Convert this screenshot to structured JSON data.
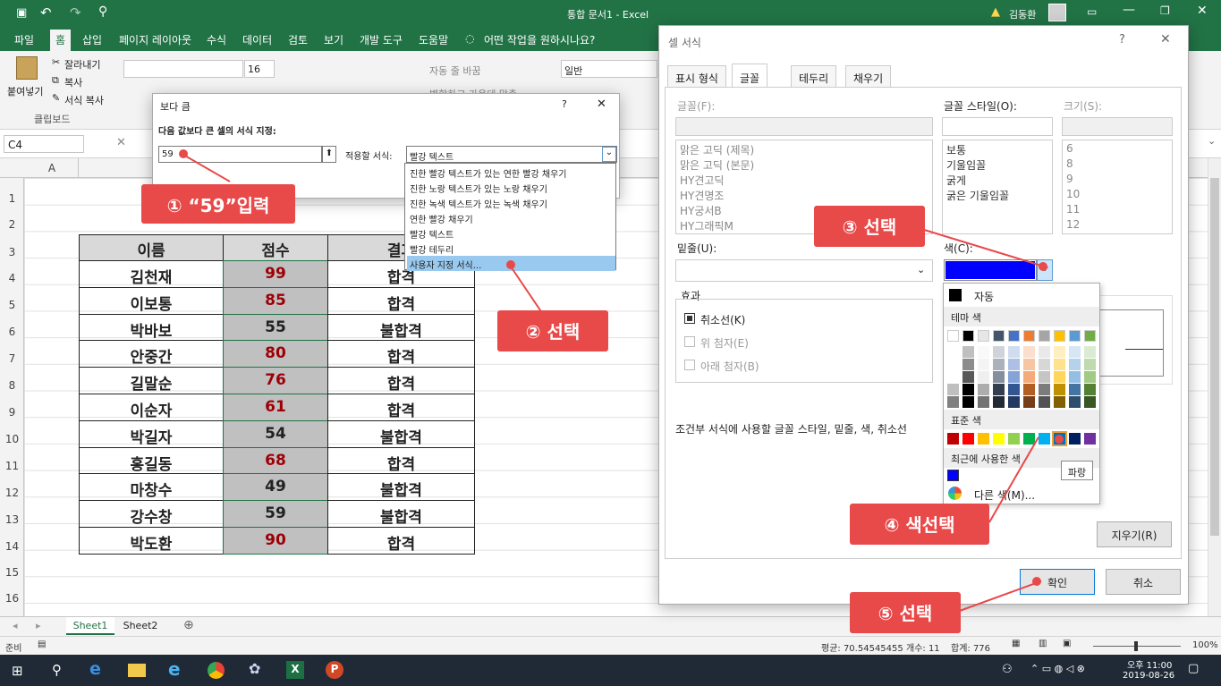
{
  "window": {
    "title": "통합 문서1 - Excel",
    "user": "김동환"
  },
  "menu": {
    "items": [
      "파일",
      "홈",
      "삽입",
      "페이지 레이아웃",
      "수식",
      "데이터",
      "검토",
      "보기",
      "개발 도구",
      "도움말"
    ],
    "tellme": "어떤 작업을 원하시나요?"
  },
  "ribbon": {
    "paste": "붙여넣기",
    "cut": "잘라내기",
    "copy": "복사",
    "format_painter": "서식 복사",
    "clipboard": "클립보드",
    "font_size": "16",
    "wrap": "자동 줄 바꿈",
    "merge": "병합하고 가운데 맞춤",
    "number_format": "일반"
  },
  "formula_bar": {
    "name_box": "C4"
  },
  "columns": [
    "A"
  ],
  "rows": [
    "1",
    "2",
    "3",
    "4",
    "5",
    "6",
    "7",
    "8",
    "9",
    "10",
    "11",
    "12",
    "13",
    "14",
    "15",
    "16"
  ],
  "table": {
    "headers": [
      "이름",
      "점수",
      "결과"
    ],
    "rows": [
      {
        "name": "김천재",
        "score": "99",
        "result": "합격"
      },
      {
        "name": "이보통",
        "score": "85",
        "result": "합격"
      },
      {
        "name": "박바보",
        "score": "55",
        "result": "불합격"
      },
      {
        "name": "안중간",
        "score": "80",
        "result": "합격"
      },
      {
        "name": "길말순",
        "score": "76",
        "result": "합격"
      },
      {
        "name": "이순자",
        "score": "61",
        "result": "합격"
      },
      {
        "name": "박길자",
        "score": "54",
        "result": "불합격"
      },
      {
        "name": "홍길동",
        "score": "68",
        "result": "합격"
      },
      {
        "name": "마창수",
        "score": "49",
        "result": "불합격"
      },
      {
        "name": "강수창",
        "score": "59",
        "result": "불합격"
      },
      {
        "name": "박도환",
        "score": "90",
        "result": "합격"
      }
    ]
  },
  "sheets": [
    "Sheet1",
    "Sheet2"
  ],
  "status": {
    "mode": "준비",
    "average": "평균: 70.54545455",
    "count": "개수: 11",
    "sum": "합계: 776",
    "zoom": "100%"
  },
  "taskbar": {
    "time": "오후 11:00",
    "date": "2019-08-26"
  },
  "greater_dialog": {
    "title": "보다 큼",
    "label": "다음 값보다 큰 셀의 서식 지정:",
    "value": "59",
    "apply_label": "적용할 서식:",
    "selected": "빨강 텍스트",
    "options": [
      "진한 빨강 텍스트가 있는 연한 빨강 채우기",
      "진한 노랑 텍스트가 있는 노랑 채우기",
      "진한 녹색 텍스트가 있는 녹색 채우기",
      "연한 빨강 채우기",
      "빨강 텍스트",
      "빨강 테두리",
      "사용자 지정 서식..."
    ]
  },
  "format_dialog": {
    "title": "셀 서식",
    "tabs": [
      "표시 형식",
      "글꼴",
      "테두리",
      "채우기"
    ],
    "font_label": "글꼴(F):",
    "fonts": [
      "맑은 고딕 (제목)",
      "맑은 고딕 (본문)",
      "HY견고딕",
      "HY견명조",
      "HY궁서B",
      "HY그래픽M"
    ],
    "style_label": "글꼴 스타일(O):",
    "styles": [
      "보통",
      "기울임꼴",
      "굵게",
      "굵은 기울임꼴"
    ],
    "size_label": "크기(S):",
    "sizes": [
      "6",
      "8",
      "9",
      "10",
      "11",
      "12"
    ],
    "underline_label": "밑줄(U):",
    "color_label": "색(C):",
    "effects_label": "효과",
    "strike": "취소선(K)",
    "superscript": "위 첨자(E)",
    "subscript": "아래 첨자(B)",
    "note": "조건부 서식에 사용할 글꼴 스타일, 밑줄, 색, 취소선",
    "clear": "지우기(R)",
    "ok": "확인",
    "cancel": "취소"
  },
  "palette": {
    "auto": "자동",
    "theme": "테마 색",
    "standard": "표준 색",
    "recent": "최근에 사용한 색",
    "more": "다른 색(M)...",
    "tooltip": "파랑",
    "theme_top": [
      "#ffffff",
      "#000000",
      "#e7e6e6",
      "#44546a",
      "#4472c4",
      "#ed7d31",
      "#a5a5a5",
      "#ffc000",
      "#5b9bd5",
      "#70ad47"
    ],
    "standard_colors": [
      "#c00000",
      "#ff0000",
      "#ffc000",
      "#ffff00",
      "#92d050",
      "#00b050",
      "#00b0f0",
      "#0070c0",
      "#002060",
      "#7030a0"
    ],
    "selected_color": "#0000ff"
  },
  "callouts": {
    "c1": "① “59”입력",
    "c2": "② 선택",
    "c3": "③ 선택",
    "c4": "④ 색선택",
    "c5": "⑤ 선택"
  }
}
